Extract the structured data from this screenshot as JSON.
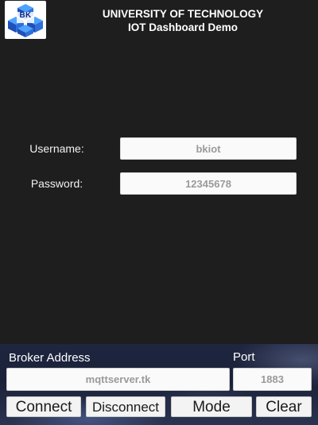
{
  "header": {
    "logo_text": "BK",
    "title_line1": "UNIVERSITY OF TECHNOLOGY",
    "title_line2": "IOT Dashboard Demo"
  },
  "login": {
    "username_label": "Username:",
    "username_value": "bkiot",
    "password_label": "Password:",
    "password_value": "12345678"
  },
  "broker": {
    "address_label": "Broker Address",
    "address_value": "mqttserver.tk",
    "port_label": "Port",
    "port_value": "1883"
  },
  "buttons": {
    "connect": "Connect",
    "disconnect": "Disconnect",
    "mode": "Mode",
    "clear": "Clear"
  },
  "colors": {
    "background": "#1e1e1e",
    "logo_blue": "#1f4fb8",
    "input_text": "#9a9a9a"
  }
}
